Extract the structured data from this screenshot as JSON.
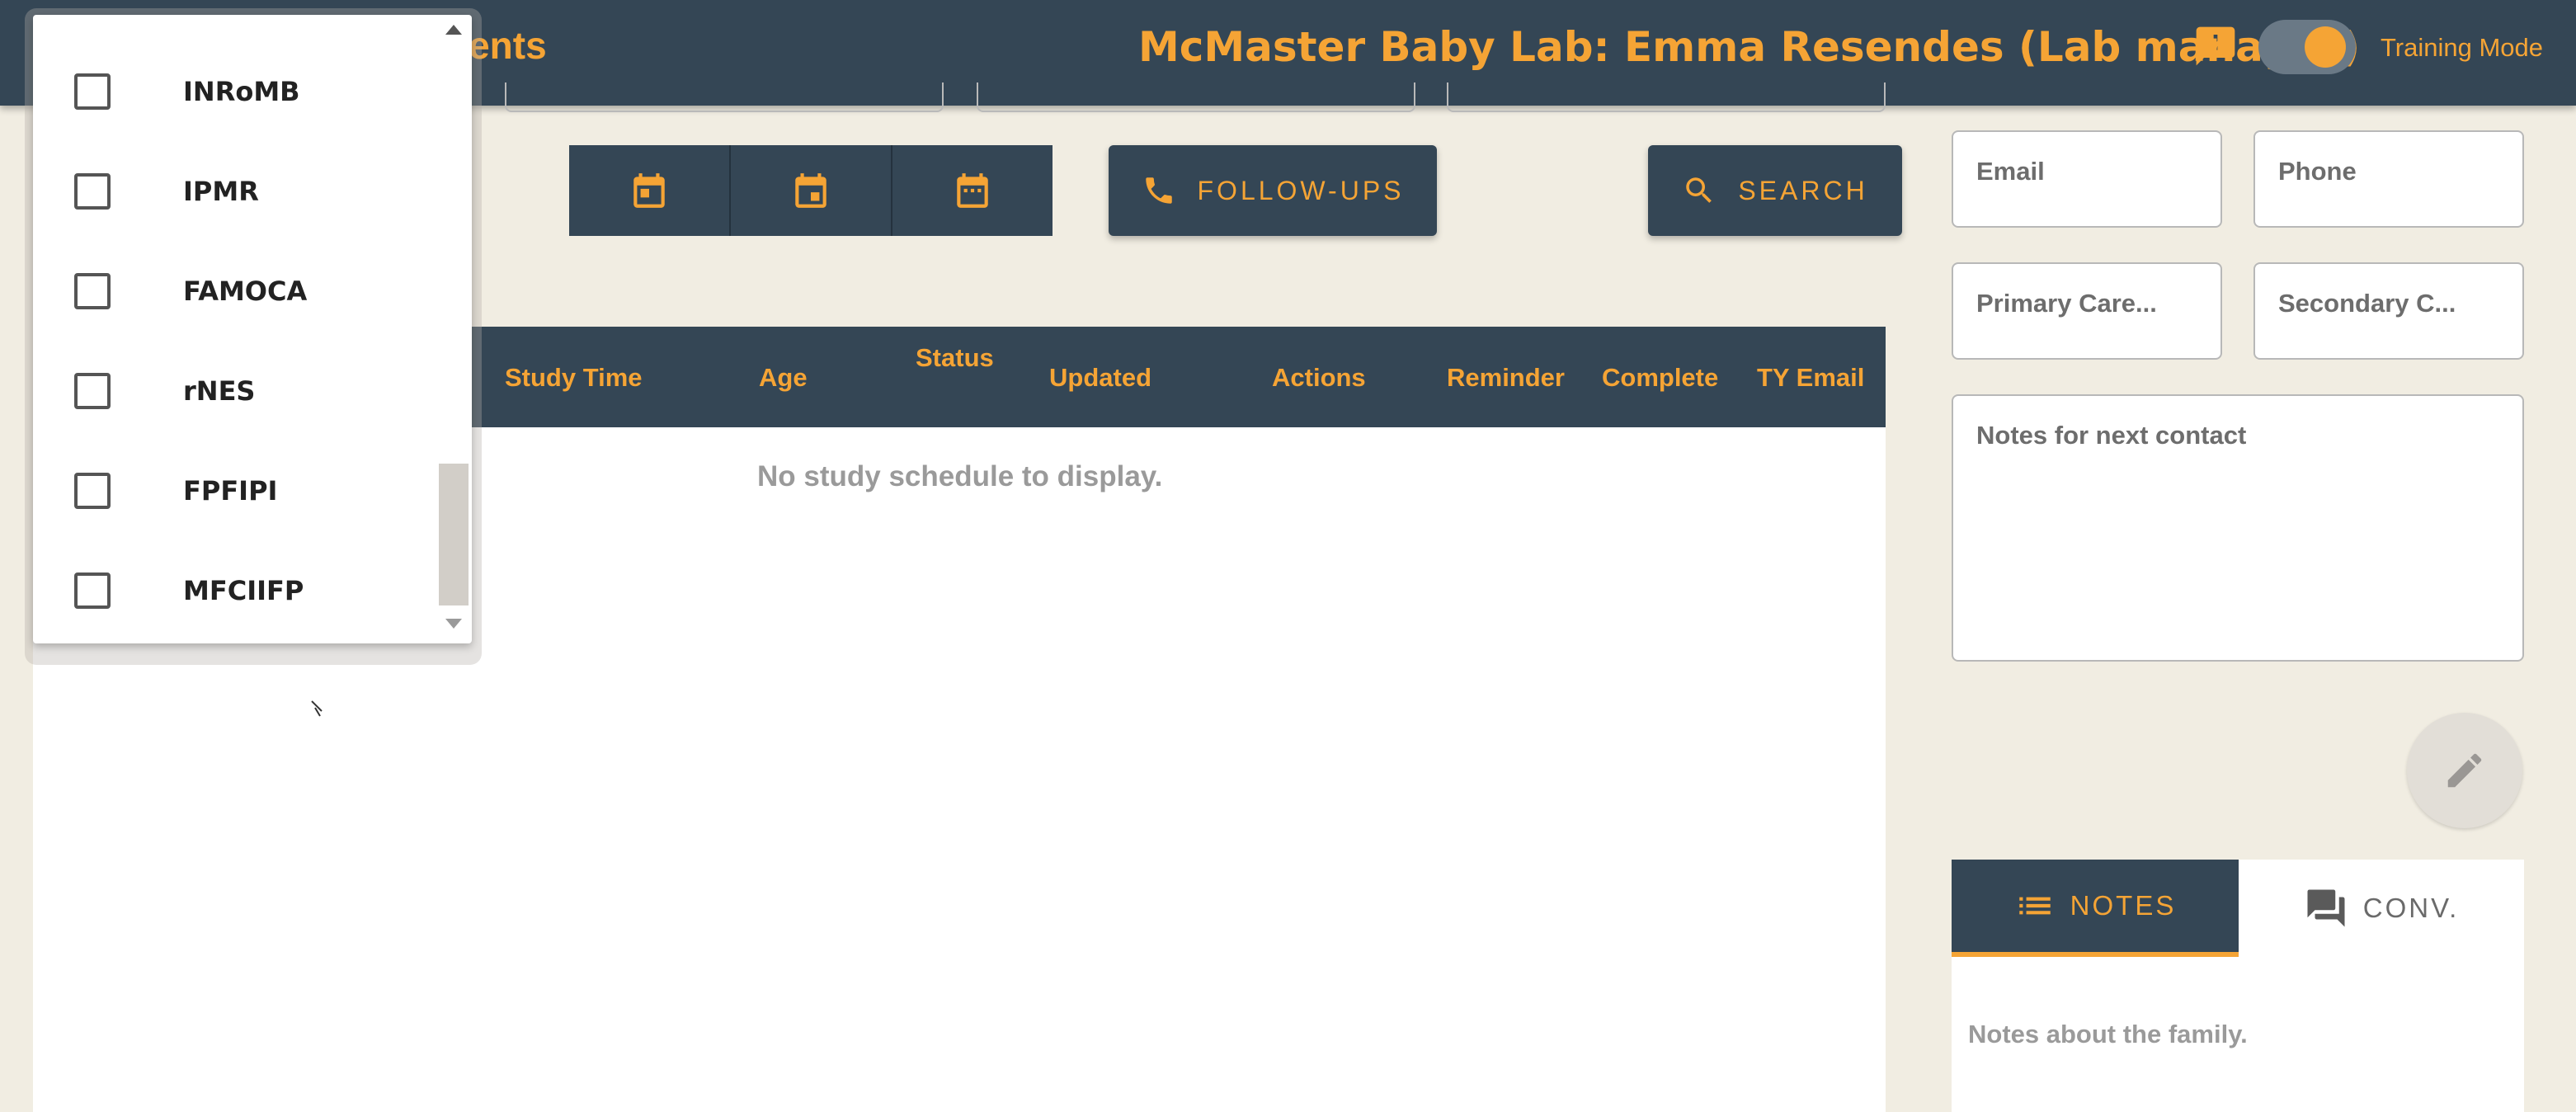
{
  "header": {
    "section_title": "nents",
    "title": "McMaster Baby Lab: Emma Resendes (Lab manager)",
    "training_mode_label": "Training Mode",
    "training_mode_on": true
  },
  "toolbar": {
    "calendar_buttons": [
      "calendar-today-icon",
      "calendar-week-icon",
      "calendar-month-icon"
    ],
    "follow_ups_label": "FOLLOW-UPS",
    "search_label": "SEARCH"
  },
  "table": {
    "columns": [
      "Study Time",
      "Age",
      "Status",
      "Updated",
      "Actions",
      "Reminder",
      "Complete",
      "TY Email"
    ],
    "empty_message": "No study schedule to display."
  },
  "family_form": {
    "email_placeholder": "Email",
    "phone_placeholder": "Phone",
    "primary_caregiver_placeholder": "Primary Care...",
    "secondary_caregiver_placeholder": "Secondary C...",
    "notes_next_contact_placeholder": "Notes for next contact"
  },
  "tabs": {
    "notes_label": "NOTES",
    "conv_label": "CONV.",
    "notes_placeholder": "Notes about the family."
  },
  "dropdown": {
    "items": [
      "INRoMB",
      "IPMR",
      "FAMOCA",
      "rNES",
      "FPFIPI",
      "MFCIIFP"
    ]
  },
  "colors": {
    "header_bg": "#344655",
    "accent": "#f5a435",
    "page_bg": "#f1ede2"
  }
}
